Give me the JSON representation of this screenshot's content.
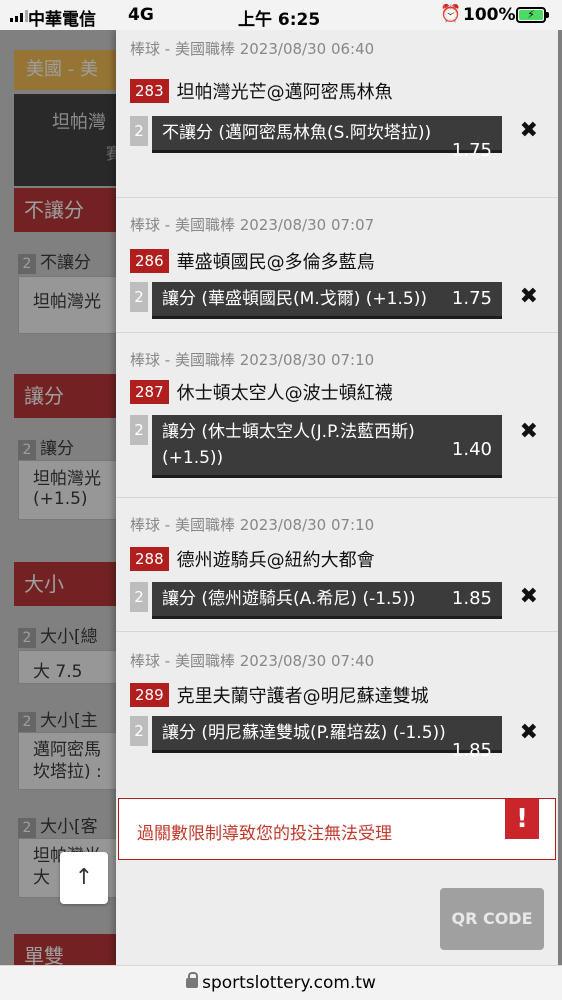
{
  "status_bar": {
    "carrier": "中華電信",
    "network": "4G",
    "time": "上午 6:25",
    "battery": "100%"
  },
  "background_page": {
    "league_tab": "美國 - 美",
    "match_team": "坦帕灣",
    "match_sub": "賽",
    "sections": [
      {
        "header": "不讓分",
        "label_num": "2",
        "label": "不讓分",
        "option": "坦帕灣光"
      },
      {
        "header": "讓分",
        "label_num": "2",
        "label": "讓分",
        "option": "坦帕灣光\n(+1.5)"
      },
      {
        "header": "大小",
        "label_num": "2",
        "label": "大小[總",
        "option": "大 7.5"
      },
      {
        "label_num": "2",
        "label": "大小[主",
        "option": "邁阿密馬\n坎塔拉) :"
      },
      {
        "label_num": "2",
        "label": "大小[客",
        "option": "坦帕灣光\n大"
      },
      {
        "header": "單雙"
      }
    ]
  },
  "bets": [
    {
      "meta": "棒球 - 美國職棒 2023/08/30 06:40",
      "game_no": "283",
      "game": "坦帕灣光芒@邁阿密馬林魚",
      "line_no": "2",
      "selection": "不讓分 (邁阿密馬林魚(S.阿坎塔拉))",
      "odds": "1.75"
    },
    {
      "meta": "棒球 - 美國職棒 2023/08/30 07:07",
      "game_no": "286",
      "game": "華盛頓國民@多倫多藍鳥",
      "line_no": "2",
      "selection": "讓分 (華盛頓國民(M.戈爾) (+1.5))",
      "odds": "1.75"
    },
    {
      "meta": "棒球 - 美國職棒 2023/08/30 07:10",
      "game_no": "287",
      "game": "休士頓太空人@波士頓紅襪",
      "line_no": "2",
      "selection": "讓分 (休士頓太空人(J.P.法藍西斯) (+1.5))",
      "odds": "1.40"
    },
    {
      "meta": "棒球 - 美國職棒 2023/08/30 07:10",
      "game_no": "288",
      "game": "德州遊騎兵@紐約大都會",
      "line_no": "2",
      "selection": "讓分 (德州遊騎兵(A.希尼) (-1.5))",
      "odds": "1.85"
    },
    {
      "meta": "棒球 - 美國職棒 2023/08/30 07:40",
      "game_no": "289",
      "game": "克里夫蘭守護者@明尼蘇達雙城",
      "line_no": "2",
      "selection": "讓分 (明尼蘇達雙城(P.羅培茲) (-1.5))",
      "odds": "1.85"
    }
  ],
  "remove_icon": "close-icon",
  "error_message": "過關數限制導致您的投注無法受理",
  "error_icon": "!",
  "qr_button": "QR CODE",
  "scroll_top": "↑",
  "url": "sportslottery.com.tw"
}
